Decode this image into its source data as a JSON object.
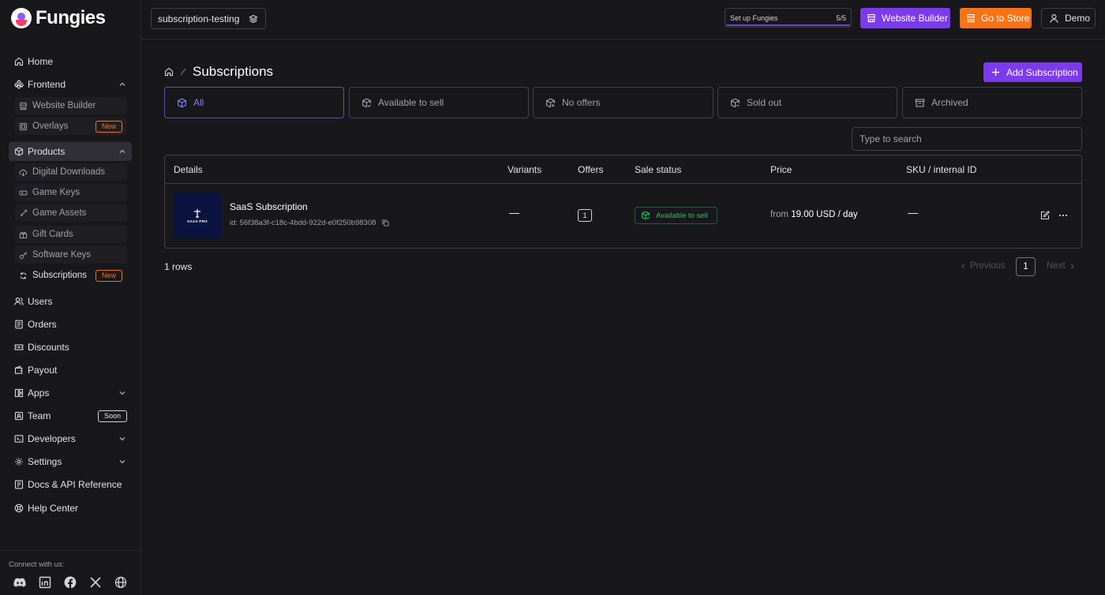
{
  "brand": {
    "name": "Fungies"
  },
  "topbar": {
    "project": "subscription-testing",
    "setup_label": "Set up Fungies",
    "setup_count": "5/5",
    "setup_progress": 1.0,
    "website_builder": "Website Builder",
    "go_to_store": "Go to Store",
    "user": "Demo"
  },
  "sidebar": {
    "items": [
      {
        "label": "Home",
        "icon": "home-icon"
      },
      {
        "label": "Frontend",
        "icon": "frontend-icon",
        "expanded": true
      },
      {
        "label": "Website Builder",
        "icon": "store-icon"
      },
      {
        "label": "Overlays",
        "icon": "overlay-icon",
        "badge": "New"
      },
      {
        "label": "Products",
        "icon": "box-icon",
        "expanded": true,
        "active": true
      },
      {
        "label": "Digital Downloads",
        "icon": "cloud-download-icon"
      },
      {
        "label": "Game Keys",
        "icon": "gamepad-icon"
      },
      {
        "label": "Game Assets",
        "icon": "sword-icon"
      },
      {
        "label": "Gift Cards",
        "icon": "gift-icon"
      },
      {
        "label": "Software Keys",
        "icon": "key-icon"
      },
      {
        "label": "Subscriptions",
        "icon": "refresh-icon",
        "badge": "New"
      },
      {
        "label": "Users",
        "icon": "users-icon"
      },
      {
        "label": "Orders",
        "icon": "receipt-icon"
      },
      {
        "label": "Discounts",
        "icon": "ticket-icon"
      },
      {
        "label": "Payout",
        "icon": "wallet-icon"
      },
      {
        "label": "Apps",
        "icon": "apps-icon"
      },
      {
        "label": "Team",
        "icon": "team-icon",
        "badge": "Soon"
      },
      {
        "label": "Developers",
        "icon": "code-icon"
      },
      {
        "label": "Settings",
        "icon": "gear-icon"
      },
      {
        "label": "Docs & API Reference",
        "icon": "book-icon"
      },
      {
        "label": "Help Center",
        "icon": "lifebuoy-icon"
      }
    ],
    "connect_label": "Connect with us:",
    "socials": [
      "discord-icon",
      "linkedin-icon",
      "facebook-icon",
      "x-icon",
      "globe-icon"
    ]
  },
  "main": {
    "title": "Subscriptions",
    "add_button": "Add Subscription",
    "tabs": [
      {
        "label": "All",
        "active": true
      },
      {
        "label": "Available to sell"
      },
      {
        "label": "No offers"
      },
      {
        "label": "Sold out"
      },
      {
        "label": "Archived"
      }
    ],
    "search_placeholder": "Type to search",
    "table": {
      "columns": [
        "Details",
        "Variants",
        "Offers",
        "Sale status",
        "Price",
        "SKU / internal ID"
      ],
      "rows": [
        {
          "thumb_label": "SAAS PRO",
          "name": "SaaS Subscription",
          "id": "id: 56f38a3f-c18c-4bdd-922d-e0f250b98308",
          "variants": "—",
          "offers": "1",
          "status": "Available to sell",
          "price_prefix": "from",
          "price_value": "19.00 USD / day",
          "sku": "—"
        }
      ]
    },
    "rows_count": "1 rows",
    "pagination": {
      "prev": "Previous",
      "page": "1",
      "next": "Next"
    }
  },
  "colors": {
    "accent": "#7c3aed",
    "store": "#f97316",
    "success": "#22c55e",
    "bg": "#18181b"
  }
}
